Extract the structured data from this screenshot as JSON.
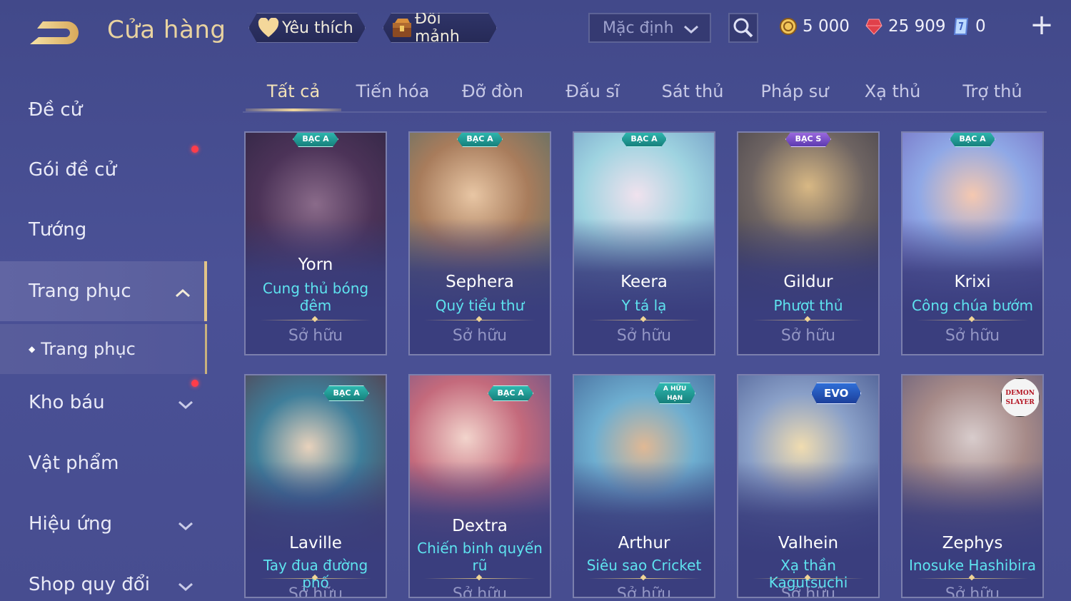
{
  "header": {
    "title": "Cửa hàng",
    "favorite_label": "Yêu thích",
    "shard_label": "Đổi mảnh",
    "sort_value": "Mặc định",
    "currency": {
      "gold": "5 000",
      "ruby": "25 909",
      "voucher": "0"
    }
  },
  "sidebar": {
    "items": [
      {
        "label": "Đề cử"
      },
      {
        "label": "Gói đề cử"
      },
      {
        "label": "Tướng"
      },
      {
        "label": "Trang phục"
      },
      {
        "label": "Trang phục"
      },
      {
        "label": "Kho báu"
      },
      {
        "label": "Vật phẩm"
      },
      {
        "label": "Hiệu ứng"
      },
      {
        "label": "Shop quy đổi"
      }
    ]
  },
  "tabs": [
    {
      "label": "Tất cả"
    },
    {
      "label": "Tiến hóa"
    },
    {
      "label": "Đỡ đòn"
    },
    {
      "label": "Đấu sĩ"
    },
    {
      "label": "Sát thủ"
    },
    {
      "label": "Pháp sư"
    },
    {
      "label": "Xạ thủ"
    },
    {
      "label": "Trợ thủ"
    }
  ],
  "cards": [
    {
      "badge": "BẠC A",
      "hero": "Yorn",
      "skin": "Cung thủ bóng đêm",
      "status": "Sở hữu",
      "art_color": "#5a3a62"
    },
    {
      "badge": "BẠC A",
      "hero": "Sephera",
      "skin": "Quý tiểu thư",
      "status": "Sở hữu",
      "art_color": "#8a6a4e"
    },
    {
      "badge": "BẠC A",
      "hero": "Keera",
      "skin": "Y tá lạ",
      "status": "Sở hữu",
      "art_color": "#8fb6cf"
    },
    {
      "badge": "BẠC S",
      "hero": "Gildur",
      "skin": "Phượt thủ",
      "status": "Sở hữu",
      "art_color": "#5e5452"
    },
    {
      "badge": "BẠC A",
      "hero": "Krixi",
      "skin": "Công chúa bướm",
      "status": "Sở hữu",
      "art_color": "#7f8fd4"
    },
    {
      "badge": "BẠC A",
      "hero": "Laville",
      "skin": "Tay đua đường phố",
      "status": "Sở hữu",
      "art_color": "#6a3c40"
    },
    {
      "badge": "BẠC A",
      "hero": "Dextra",
      "skin": "Chiến binh quyến rũ",
      "status": "Sở hữu",
      "art_color": "#a56a7a"
    },
    {
      "badge": "A HỮU HẠN",
      "hero": "Arthur",
      "skin": "Siêu sao Cricket",
      "status": "Sở hữu",
      "art_color": "#6fa6c8"
    },
    {
      "badge": "EVO",
      "hero": "Valhein",
      "skin": "Xạ thần Kagutsuchi",
      "status": "Sở hữu",
      "art_color": "#6b7bb0"
    },
    {
      "badge": "DEMON SLAYER",
      "hero": "Zephys",
      "skin": "Inosuke Hashibira",
      "status": "Sở hữu",
      "art_color": "#8a8aa8"
    }
  ]
}
